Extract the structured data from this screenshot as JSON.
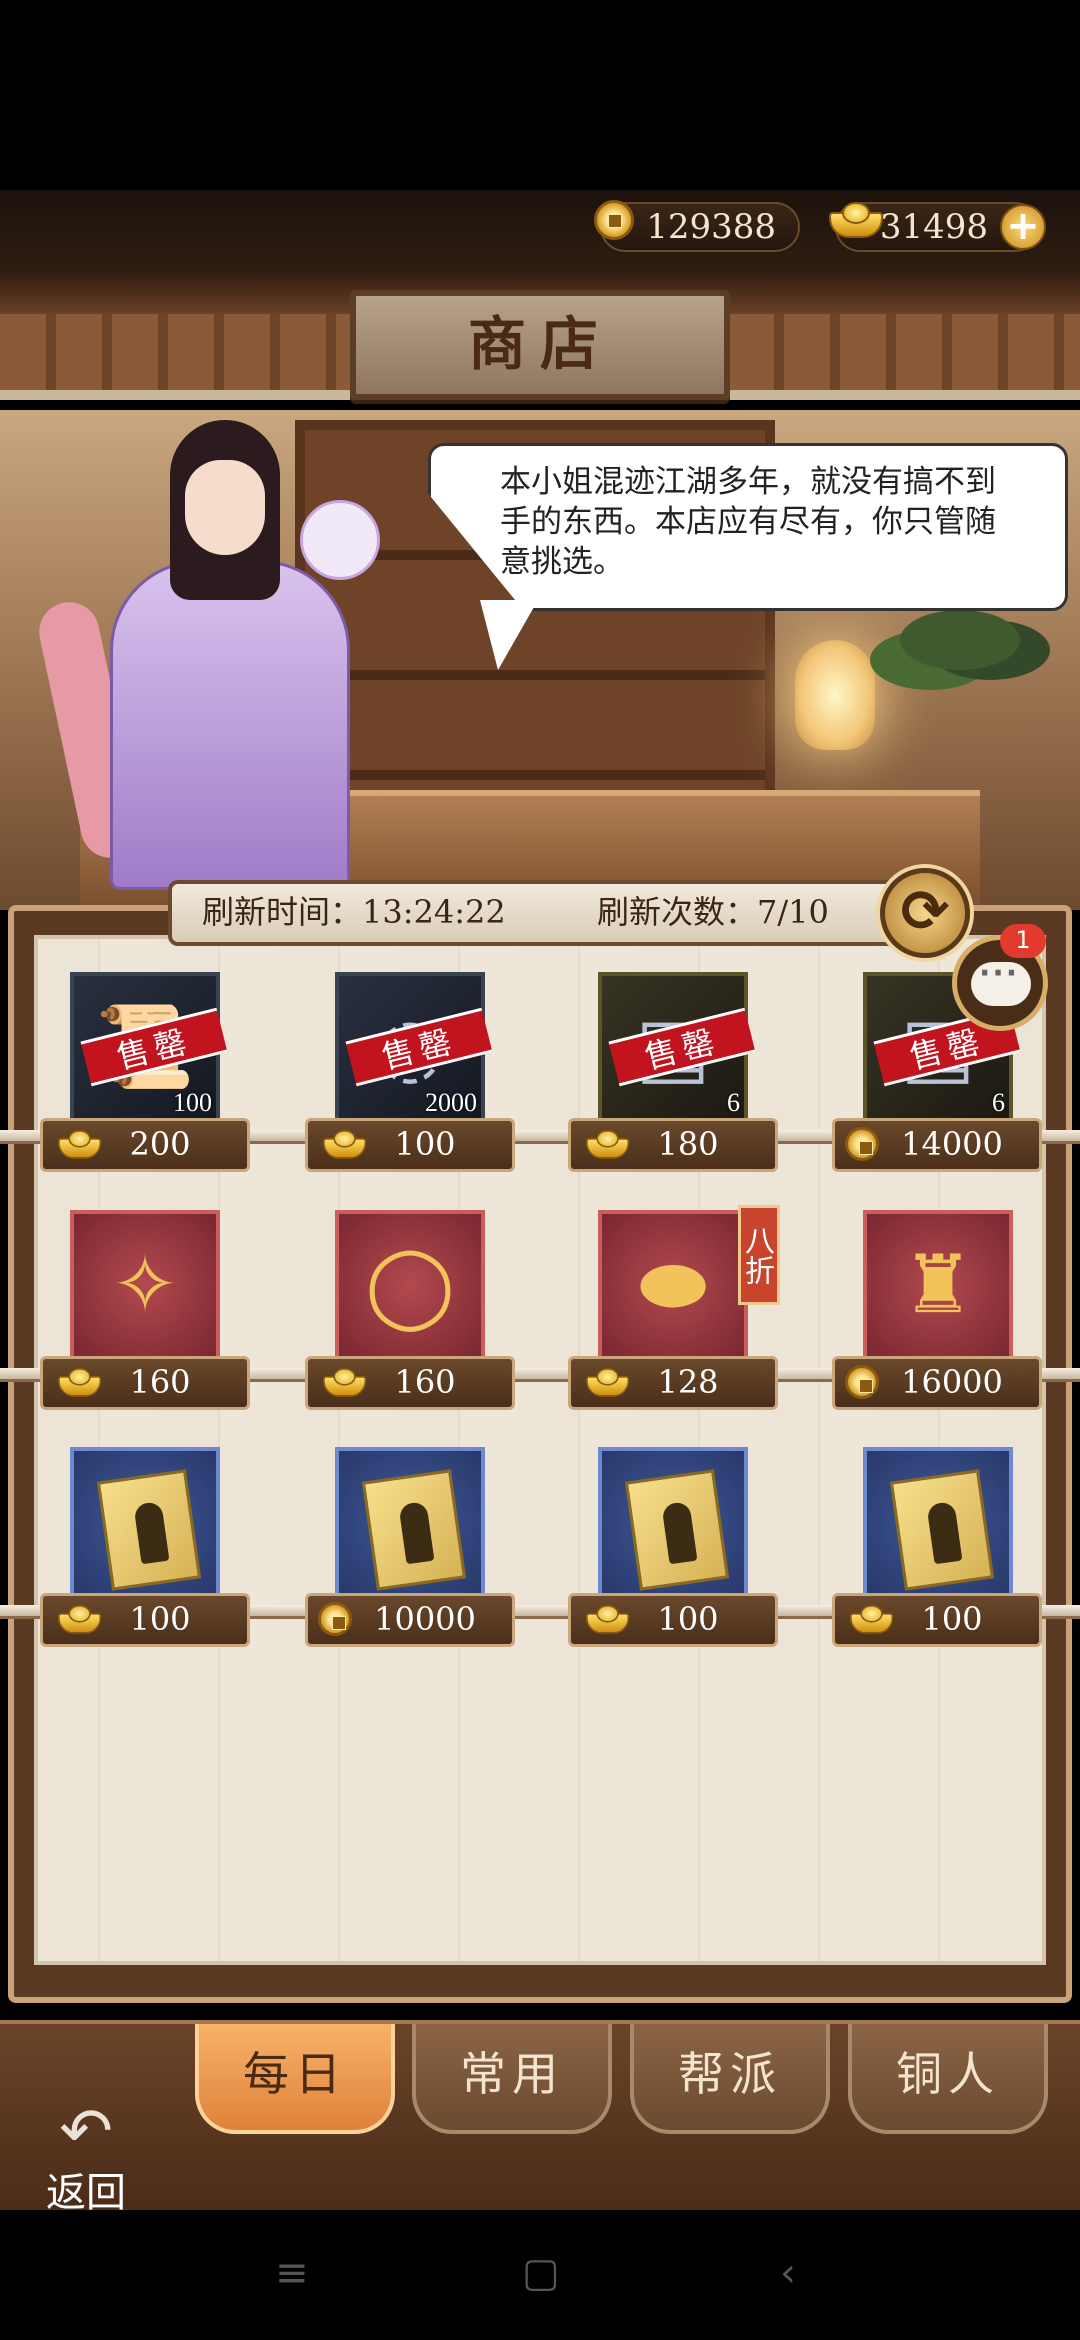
{
  "currency": {
    "coins": "129388",
    "ingots": "31498",
    "add_icon": "plus-icon"
  },
  "shop_title": "商店",
  "dialog": {
    "text": "本小姐混迹江湖多年，就没有搞不到手的东西。本店应有尽有，你只管随意挑选。"
  },
  "refresh": {
    "time_label": "刷新时间：13:24:22",
    "count_label": "刷新次数：7/10"
  },
  "chat": {
    "badge": "1"
  },
  "sold_out_label": "售罄",
  "discount_label": "八折",
  "items": [
    {
      "qty": "100",
      "price": "200",
      "currency": "ingot",
      "sold_out": true,
      "icon": "scroll-icon"
    },
    {
      "qty": "2000",
      "price": "100",
      "currency": "ingot",
      "sold_out": true,
      "icon": "swirl-icon"
    },
    {
      "qty": "6",
      "price": "180",
      "currency": "ingot",
      "sold_out": true,
      "icon": "manual-book-icon"
    },
    {
      "qty": "6",
      "price": "14000",
      "currency": "coin",
      "sold_out": true,
      "icon": "manual-book-icon"
    },
    {
      "qty": "",
      "price": "160",
      "currency": "ingot",
      "sold_out": false,
      "icon": "hairpin-icon"
    },
    {
      "qty": "",
      "price": "160",
      "currency": "ingot",
      "sold_out": false,
      "icon": "necklace-icon"
    },
    {
      "qty": "",
      "price": "128",
      "currency": "ingot",
      "sold_out": false,
      "icon": "belt-icon",
      "discount": true
    },
    {
      "qty": "",
      "price": "16000",
      "currency": "coin",
      "sold_out": false,
      "icon": "robe-icon"
    },
    {
      "qty": "",
      "price": "100",
      "currency": "ingot",
      "sold_out": false,
      "icon": "skill-card-icon"
    },
    {
      "qty": "",
      "price": "10000",
      "currency": "coin",
      "sold_out": false,
      "icon": "skill-card-icon"
    },
    {
      "qty": "",
      "price": "100",
      "currency": "ingot",
      "sold_out": false,
      "icon": "skill-card-icon"
    },
    {
      "qty": "",
      "price": "100",
      "currency": "ingot",
      "sold_out": false,
      "icon": "skill-card-icon"
    }
  ],
  "tabs": [
    {
      "label": "每日",
      "active": true
    },
    {
      "label": "常用",
      "active": false
    },
    {
      "label": "帮派",
      "active": false
    },
    {
      "label": "铜人",
      "active": false
    }
  ],
  "back_label": "返回",
  "colors": {
    "accent": "#e0813a",
    "sold_out": "#c2141e",
    "panel": "#5a3a22"
  }
}
